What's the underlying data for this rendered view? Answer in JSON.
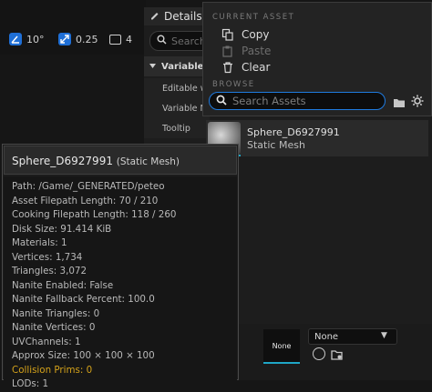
{
  "viewport": {
    "angle_snap": "10°",
    "scale_snap": "0.25",
    "camera_speed": "4"
  },
  "details": {
    "tab_label": "Details",
    "search_placeholder": "Search",
    "category": "Variable",
    "rows": [
      "Editable wh",
      "Variable Na",
      "Tooltip"
    ]
  },
  "menu": {
    "current_asset_header": "CURRENT ASSET",
    "copy": "Copy",
    "paste": "Paste",
    "clear": "Clear",
    "browse_header": "BROWSE",
    "search_placeholder": "Search Assets"
  },
  "asset": {
    "name": "Sphere_D6927991",
    "type": "Static Mesh"
  },
  "bottom": {
    "swatch_label": "None",
    "select_value": "None"
  },
  "tooltip": {
    "title": "Sphere_D6927991",
    "title_type": "(Static Mesh)",
    "lines": [
      "Path: /Game/_GENERATED/peteo",
      "Asset Filepath Length: 70 / 210",
      "Cooking Filepath Length: 118 / 260",
      "Disk Size: 91.414 KiB",
      "Materials: 1",
      "Vertices: 1,734",
      "Triangles: 3,072",
      "Nanite Enabled: False",
      "Nanite Fallback Percent: 100.0",
      "Nanite Triangles: 0",
      "Nanite Vertices: 0",
      "UVChannels: 1",
      "Approx Size: 100 × 100 × 100",
      "Collision Prims: 0",
      "LODs: 1"
    ],
    "warning_line": "Collision Prims: 0"
  },
  "colors": {
    "accent_blue": "#1f7be0",
    "accent_cyan": "#1fa6c6",
    "warning": "#d4a21a"
  }
}
